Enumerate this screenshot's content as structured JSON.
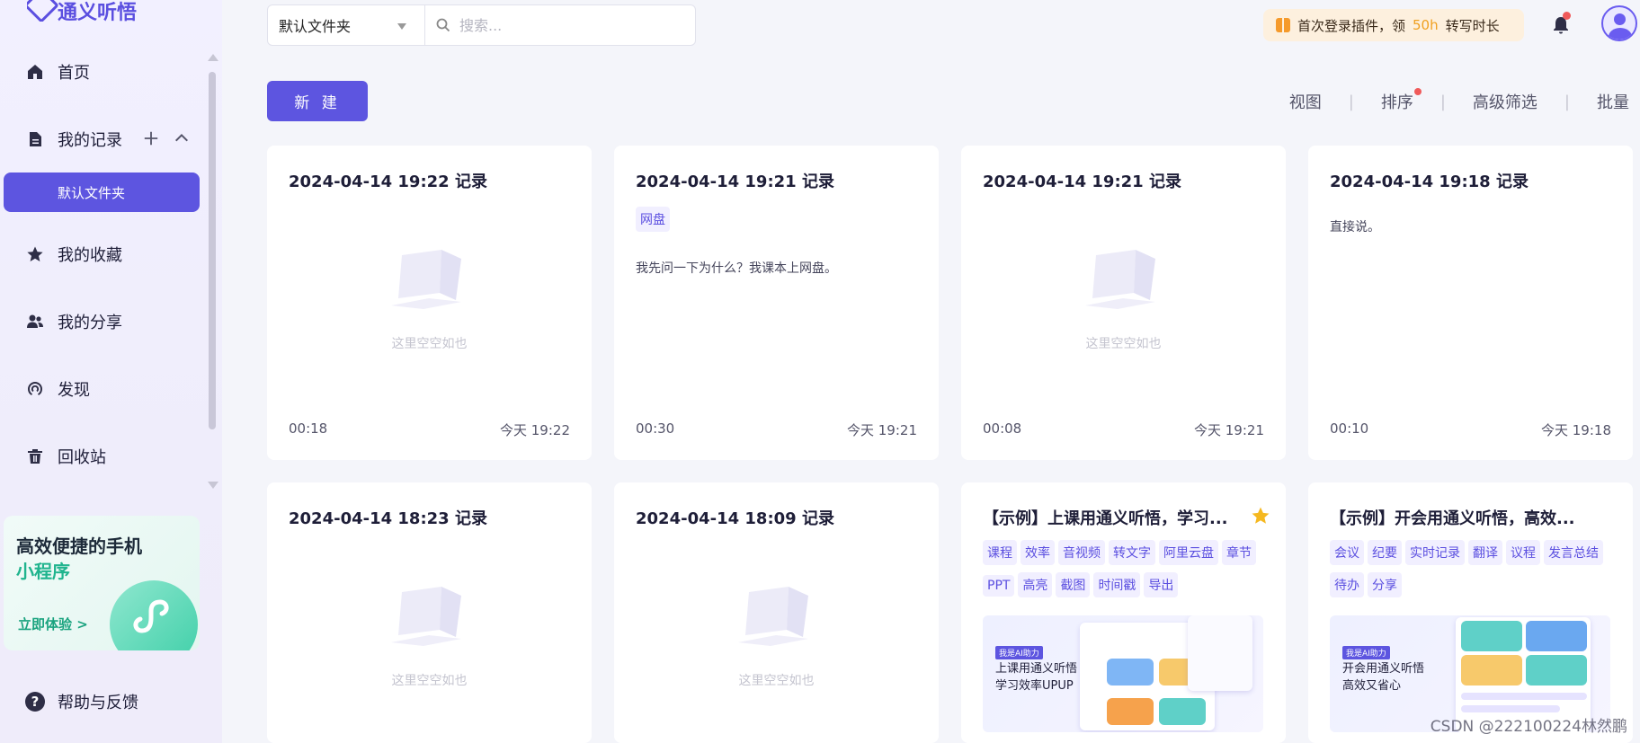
{
  "app": {
    "name": "通义听悟"
  },
  "sidebar": {
    "nav": [
      {
        "label": "首页"
      },
      {
        "label": "我的记录"
      },
      {
        "label": "我的收藏"
      },
      {
        "label": "我的分享"
      },
      {
        "label": "发现"
      },
      {
        "label": "回收站"
      }
    ],
    "active_folder": "默认文件夹",
    "promo": {
      "line1": "高效便捷的手机",
      "line2": "小程序",
      "cta": "立即体验 >"
    },
    "help": "帮助与反馈"
  },
  "topbar": {
    "folder_select": "默认文件夹",
    "search_placeholder": "搜索...",
    "promo_pre": "首次登录插件，领",
    "promo_highlight": "50h",
    "promo_post": "转写时长"
  },
  "actions": {
    "new_button": "新 建",
    "view": "视图",
    "sort": "排序",
    "filter": "高级筛选",
    "batch": "批量"
  },
  "records": [
    {
      "title": "2024-04-14 19:22 记录",
      "empty": "这里空空如也",
      "duration": "00:18",
      "time": "今天 19:22"
    },
    {
      "title": "2024-04-14 19:21 记录",
      "tag": "网盘",
      "snippet": "我先问一下为什么？我课本上网盘。",
      "duration": "00:30",
      "time": "今天 19:21"
    },
    {
      "title": "2024-04-14 19:21 记录",
      "empty": "这里空空如也",
      "duration": "00:08",
      "time": "今天 19:21"
    },
    {
      "title": "2024-04-14 19:18 记录",
      "snippet": "直接说。",
      "duration": "00:10",
      "time": "今天 19:18"
    },
    {
      "title": "2024-04-14 18:23 记录",
      "empty": "这里空空如也"
    },
    {
      "title": "2024-04-14 18:09 记录",
      "empty": "这里空空如也"
    },
    {
      "title": "【示例】上课用通义听悟，学习...",
      "tags": [
        "课程",
        "效率",
        "音视频",
        "转文字",
        "阿里云盘",
        "章节",
        "PPT",
        "高亮",
        "截图",
        "时间戳",
        "导出"
      ],
      "preview_badge": "我是AI助力",
      "preview_line1": "上课用通义听悟",
      "preview_line2": "学习效率UPUP"
    },
    {
      "title": "【示例】开会用通义听悟，高效...",
      "tags": [
        "会议",
        "纪要",
        "实时记录",
        "翻译",
        "议程",
        "发言总结",
        "待办",
        "分享"
      ],
      "preview_badge": "我是AI助力",
      "preview_line1": "开会用通义听悟",
      "preview_line2": "高效又省心"
    }
  ],
  "watermark": "CSDN @222100224林然鹏",
  "colors": {
    "accent": "#5d55e0",
    "accent_text": "#5b4fe0",
    "promo_bg": "#fdf0de",
    "promo_highlight": "#f0a020",
    "star": "#f5b820",
    "notification_dot": "#f05a5a"
  },
  "icons": [
    "home-icon",
    "document-icon",
    "star-icon",
    "users-icon",
    "discover-icon",
    "trash-icon",
    "search-icon",
    "gift-icon",
    "bell-icon",
    "help-icon",
    "plus-icon",
    "chevron-up-icon",
    "miniprogram-icon"
  ]
}
